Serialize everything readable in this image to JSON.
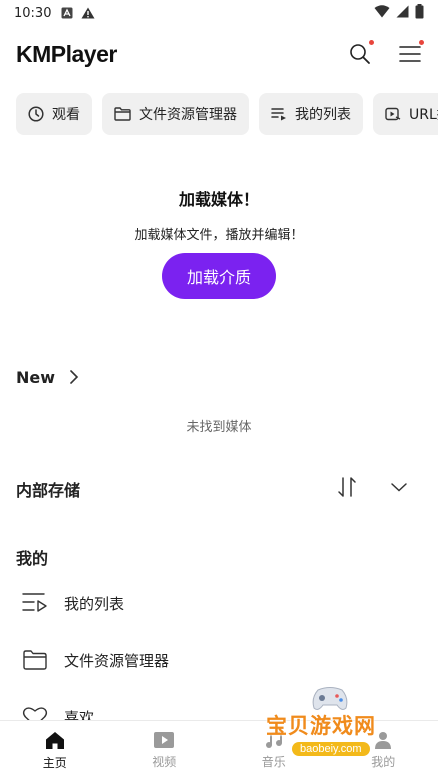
{
  "status_bar": {
    "time": "10:30"
  },
  "header": {
    "logo": "KMPlayer"
  },
  "chips": [
    {
      "label": "观看",
      "icon": "clock-icon"
    },
    {
      "label": "文件资源管理器",
      "icon": "folder-icon"
    },
    {
      "label": "我的列表",
      "icon": "playlist-icon"
    },
    {
      "label": "URL播",
      "icon": "url-play-icon"
    }
  ],
  "empty_state": {
    "title": "加载媒体！",
    "subtitle": "加载媒体文件，播放并编辑！",
    "button": "加载介质"
  },
  "new_section": {
    "title": "New",
    "empty_message": "未找到媒体"
  },
  "storage_section": {
    "title": "内部存储"
  },
  "mine_section": {
    "title": "我的",
    "items": [
      {
        "label": "我的列表"
      },
      {
        "label": "文件资源管理器"
      },
      {
        "label": "喜欢"
      }
    ]
  },
  "bottom_nav": [
    {
      "label": "主页",
      "active": true
    },
    {
      "label": "视频",
      "active": false
    },
    {
      "label": "音乐",
      "active": false
    },
    {
      "label": "我的",
      "active": false
    }
  ],
  "watermark": {
    "text": "宝贝游戏网",
    "url": "baobeiy.com"
  },
  "colors": {
    "accent": "#7b22f0",
    "notification": "#e8453c",
    "chip_bg": "#f0f0f0"
  }
}
